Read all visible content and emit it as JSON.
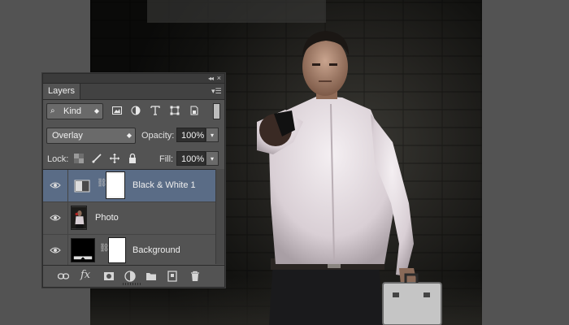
{
  "panel": {
    "title": "Layers",
    "filter": {
      "kind_label": "Kind"
    },
    "blend_mode": "Overlay",
    "opacity_label": "Opacity:",
    "opacity_value": "100%",
    "lock_label": "Lock:",
    "fill_label": "Fill:",
    "fill_value": "100%",
    "layers": [
      {
        "name": "Black & White 1",
        "selected": true
      },
      {
        "name": "Photo",
        "selected": false
      },
      {
        "name": "Background",
        "selected": false
      }
    ],
    "fx_label": "fx"
  },
  "colors": {
    "ui_gray": "#535353",
    "selected_row": "#5a6c86",
    "dark_field": "#2f2f2f"
  },
  "icons": [
    "collapse-icon",
    "close-icon",
    "panel-menu-icon",
    "search-icon",
    "image-filter-icon",
    "adjustment-filter-icon",
    "type-filter-icon",
    "shape-filter-icon",
    "smart-object-filter-icon",
    "eye-icon",
    "link-icon",
    "fx-icon",
    "mask-icon",
    "new-adjustment-icon",
    "group-icon",
    "new-layer-icon",
    "trash-icon"
  ]
}
